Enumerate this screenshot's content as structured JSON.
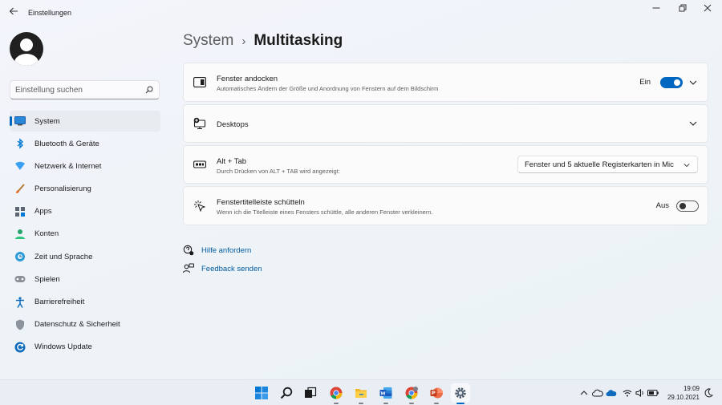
{
  "window": {
    "title": "Einstellungen"
  },
  "search": {
    "placeholder": "Einstellung suchen"
  },
  "sidebar": {
    "items": [
      {
        "label": "System",
        "icon": "system-icon",
        "active": true
      },
      {
        "label": "Bluetooth & Geräte",
        "icon": "bluetooth-icon"
      },
      {
        "label": "Netzwerk & Internet",
        "icon": "network-icon"
      },
      {
        "label": "Personalisierung",
        "icon": "brush-icon"
      },
      {
        "label": "Apps",
        "icon": "apps-icon"
      },
      {
        "label": "Konten",
        "icon": "account-icon"
      },
      {
        "label": "Zeit und Sprache",
        "icon": "globe-clock-icon"
      },
      {
        "label": "Spielen",
        "icon": "gamepad-icon"
      },
      {
        "label": "Barrierefreiheit",
        "icon": "accessibility-icon"
      },
      {
        "label": "Datenschutz & Sicherheit",
        "icon": "shield-icon"
      },
      {
        "label": "Windows Update",
        "icon": "update-icon"
      }
    ]
  },
  "breadcrumb": {
    "parent": "System",
    "separator": "›",
    "current": "Multitasking"
  },
  "settings": {
    "snap": {
      "title": "Fenster andocken",
      "subtitle": "Automatisches Ändern der Größe und Anordnung von Fenstern auf dem Bildschirm",
      "state_label": "Ein",
      "on": true
    },
    "desktops": {
      "title": "Desktops"
    },
    "alttab": {
      "title": "Alt + Tab",
      "subtitle": "Durch Drücken von ALT + TAB wird angezeigt:",
      "selected": "Fenster und 5 aktuelle Registerkarten in Mic"
    },
    "shake": {
      "title": "Fenstertitelleiste schütteln",
      "subtitle": "Wenn ich die Titelleiste eines Fensters schüttle, alle anderen Fenster verkleinern.",
      "state_label": "Aus",
      "on": false
    }
  },
  "links": {
    "help": "Hilfe anfordern",
    "feedback": "Feedback senden"
  },
  "taskbar": {
    "apps": [
      "start-icon",
      "search-icon",
      "task-view-icon",
      "chrome-icon",
      "file-explorer-icon",
      "word-icon",
      "chrome-profile-icon",
      "powerpoint-icon",
      "settings-icon"
    ],
    "tray": [
      "chevron-up-icon",
      "onedrive-icon",
      "onedrive-business-icon",
      "wifi-icon",
      "volume-icon",
      "battery-icon",
      "moon-icon"
    ]
  },
  "clock": {
    "time": "19:09",
    "date": "29.10.2021"
  },
  "colors": {
    "accent": "#0067c0",
    "link": "#005a9e"
  }
}
